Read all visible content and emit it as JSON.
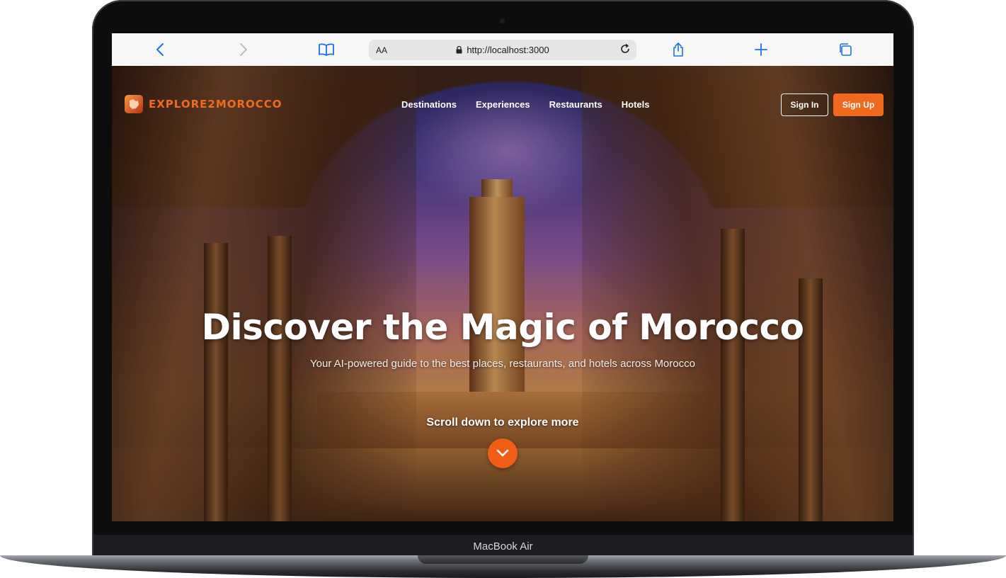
{
  "device": {
    "label": "MacBook Air"
  },
  "browser": {
    "address": {
      "text_size_label": "AA",
      "url": "http://localhost:3000"
    },
    "icons": [
      "back-icon",
      "forward-icon",
      "bookmarks-icon",
      "reload-icon",
      "share-icon",
      "new-tab-icon",
      "tabs-icon"
    ]
  },
  "site": {
    "logo_text": "EXPLORE2MOROCCO",
    "nav": [
      "Destinations",
      "Experiences",
      "Restaurants",
      "Hotels"
    ],
    "sign_in": "Sign In",
    "sign_up": "Sign Up",
    "accent_color": "#ef6a1f"
  },
  "hero": {
    "title": "Discover the Magic of Morocco",
    "subtitle": "Your AI-powered guide to the best places, restaurants, and hotels across Morocco",
    "scroll_text": "Scroll down to explore more"
  }
}
